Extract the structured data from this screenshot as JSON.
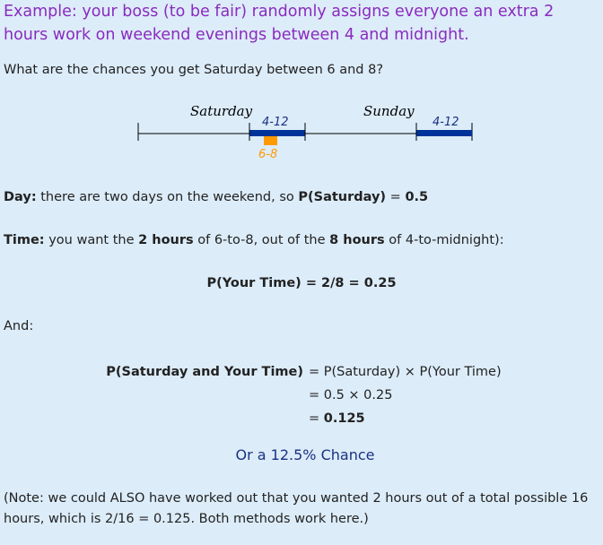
{
  "heading": "Example: your boss (to be fair) randomly assigns everyone an extra 2 hours work on weekend evenings between 4 and midnight.",
  "question": "What are the chances you get Saturday between 6 and 8?",
  "diagram": {
    "saturday_label": "Saturday",
    "sunday_label": "Sunday",
    "sat_range_label": "4-12",
    "sun_range_label": "4-12",
    "your_time_label": "6-8",
    "colors": {
      "line": "#000000",
      "range_bar": "#003399",
      "your_time": "#ff9900",
      "label": "#1a3282"
    }
  },
  "day": {
    "lead": "Day:",
    "text": " there are two days on the weekend, so ",
    "prob_label": "P(Saturday)",
    "equals": " = ",
    "value": "0.5"
  },
  "time": {
    "lead": "Time:",
    "text1": " you want the ",
    "bold1": "2 hours",
    "text2": " of 6-to-8, out of the ",
    "bold2": "8 hours",
    "text3": " of 4-to-midnight):"
  },
  "your_time_eq": "P(Your Time) = 2/8 = 0.25",
  "and_label": "And:",
  "combined": {
    "lhs": "P(Saturday and Your Time)",
    "line1": "= P(Saturday) × P(Your Time)",
    "line2": "= 0.5 × 0.25",
    "line3_eq": "= ",
    "line3_val": "0.125"
  },
  "chance": "Or a 12.5% Chance",
  "note": "(Note: we could ALSO have worked out that you wanted 2 hours out of a total possible 16 hours, which is 2/16 = 0.125. Both methods work here.)"
}
